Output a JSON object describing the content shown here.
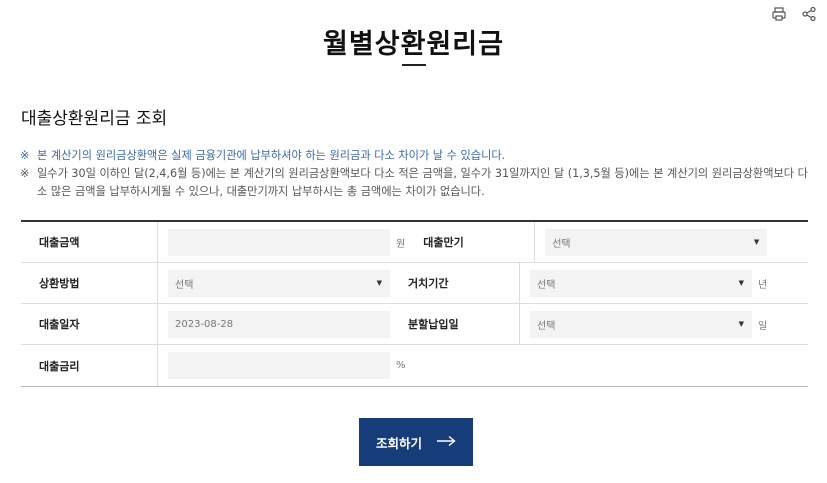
{
  "header": {
    "title": "월별상환원리금"
  },
  "section": {
    "title": "대출상환원리금 조회"
  },
  "notes": [
    {
      "mark": "※",
      "text": "본 계산기의 원리금상환액은 실제 금융기관에 납부하셔야 하는 원리금과 다소 차이가 날 수 있습니다."
    },
    {
      "mark": "※",
      "text": "일수가 30일 이하인 달(2,4,6월 등)에는 본 계산기의 원리금상환액보다 다소 적은 금액을, 일수가 31일까지인 달 (1,3,5월 등)에는 본 계산기의 원리금상환액보다 다소 많은 금액을 납부하시게될 수 있으나, 대출만기까지 납부하시는 총 금액에는 차이가 없습니다."
    }
  ],
  "form": {
    "loan_amount": {
      "label": "대출금액",
      "value": "",
      "unit": "원"
    },
    "loan_term": {
      "label": "대출만기",
      "value": "선택"
    },
    "repay_method": {
      "label": "상환방법",
      "value": "선택"
    },
    "grace_period": {
      "label": "거치기간",
      "value": "선택",
      "unit": "년"
    },
    "loan_date": {
      "label": "대출일자",
      "value": "2023-08-28"
    },
    "pay_day": {
      "label": "분할납입일",
      "value": "선택",
      "unit": "일"
    },
    "interest_rate": {
      "label": "대출금리",
      "value": "",
      "unit": "%"
    }
  },
  "actions": {
    "submit_label": "조회하기"
  },
  "colors": {
    "button_bg": "#163c79",
    "note_blue": "#3a6aa8"
  },
  "icons": [
    "print-icon",
    "share-icon",
    "arrow-right-icon",
    "dropdown-arrow-icon"
  ]
}
